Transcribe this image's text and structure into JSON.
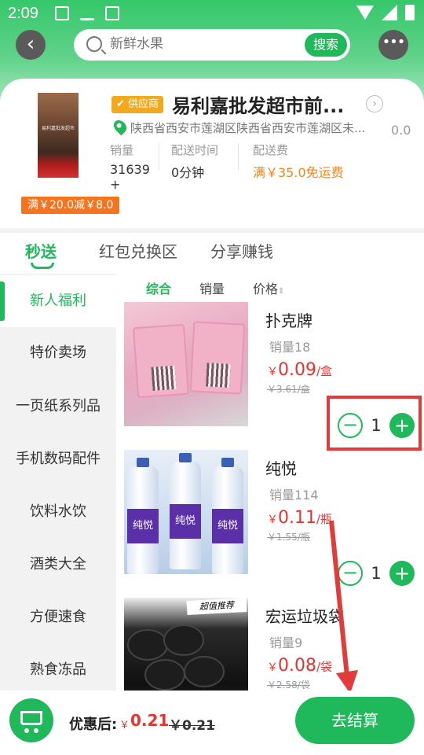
{
  "status_bar": {
    "time": "2:09"
  },
  "search": {
    "placeholder": "新鲜水果",
    "button": "搜索"
  },
  "store": {
    "tag": "供应商",
    "name": "易利嘉批发超市前...",
    "address": "陕西省西安市莲湖区陕西省西安市莲湖区未...",
    "rating": "0.0",
    "stats": [
      {
        "label": "销量",
        "value": "31639"
      },
      {
        "label": "配送时间",
        "value": "0分钟"
      },
      {
        "label": "配送费",
        "value": "满￥35.0免运费"
      }
    ],
    "stat_extra": "+",
    "promo": "满￥20.0减￥8.0",
    "image_text": "易利嘉批发超市"
  },
  "tabs": [
    "秒送",
    "红包兑换区",
    "分享赚钱"
  ],
  "sort": [
    "综合",
    "销量",
    "价格"
  ],
  "categories": [
    "新人福利",
    "特价卖场",
    "一页纸系列品",
    "手机数码配件",
    "饮料水饮",
    "酒类大全",
    "方便速食",
    "熟食冻品"
  ],
  "products": [
    {
      "name": "扑克牌",
      "sales": "销量18",
      "currency": "￥",
      "price": "0.09",
      "unit": "/盒",
      "orig": "￥3.61/盒",
      "qty": "1"
    },
    {
      "name": "纯悦",
      "sales": "销量114",
      "currency": "￥",
      "price": "0.11",
      "unit": "/瓶",
      "orig": "￥1.55/瓶",
      "qty": "1",
      "bottle_label": "纯悦"
    },
    {
      "name": "宏运垃圾袋",
      "sales": "销量9",
      "currency": "￥",
      "price": "0.08",
      "unit": "/袋",
      "orig": "￥2.58/袋",
      "banner": "超值推荐"
    }
  ],
  "bottom": {
    "label": "优惠后:",
    "currency": "￥",
    "price": "0.21",
    "orig": "￥0.21",
    "checkout": "去结算"
  },
  "colors": {
    "accent": "#1fb85a",
    "price": "#e8322e",
    "promo": "#f5741d",
    "annotation": "#e23b3b"
  }
}
